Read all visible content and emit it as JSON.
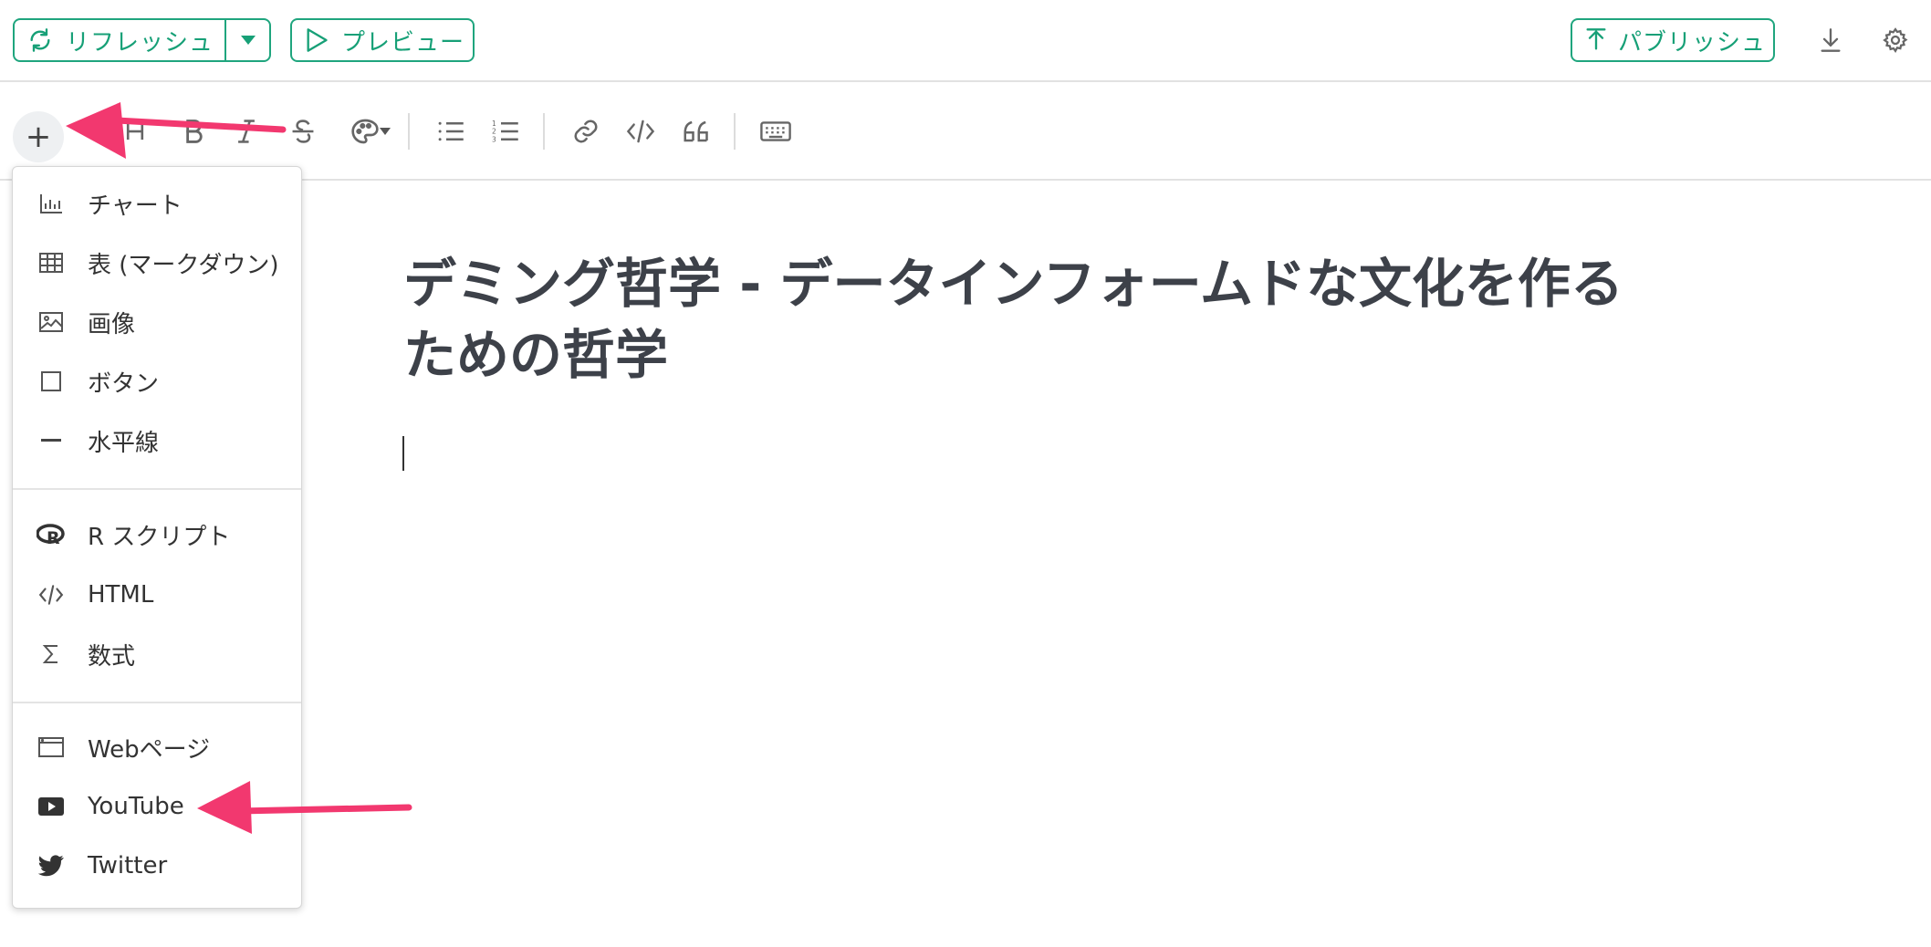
{
  "topbar": {
    "refresh_label": "リフレッシュ",
    "preview_label": "プレビュー",
    "publish_label": "パブリッシュ"
  },
  "toolbar": {
    "insert_symbol": "+"
  },
  "menu": {
    "items": [
      {
        "label": "チャート",
        "icon": "chart-icon"
      },
      {
        "label": "表 (マークダウン)",
        "icon": "table-icon"
      },
      {
        "label": "画像",
        "icon": "image-icon"
      },
      {
        "label": "ボタン",
        "icon": "button-icon"
      },
      {
        "label": "水平線",
        "icon": "horizontal-line-icon"
      },
      {
        "label": "R スクリプト",
        "icon": "r-logo-icon"
      },
      {
        "label": "HTML",
        "icon": "code-icon"
      },
      {
        "label": "数式",
        "icon": "sigma-icon"
      },
      {
        "label": "Webページ",
        "icon": "browser-window-icon"
      },
      {
        "label": "YouTube",
        "icon": "youtube-icon"
      },
      {
        "label": "Twitter",
        "icon": "twitter-icon"
      }
    ]
  },
  "editor": {
    "title_line1": "デミング哲学 - データインフォームドな文化を作る",
    "title_line2": "ための哲学"
  },
  "colors": {
    "accent": "#1fa57e",
    "annotation_arrow": "#f2386f",
    "title_text": "#3d4149"
  }
}
